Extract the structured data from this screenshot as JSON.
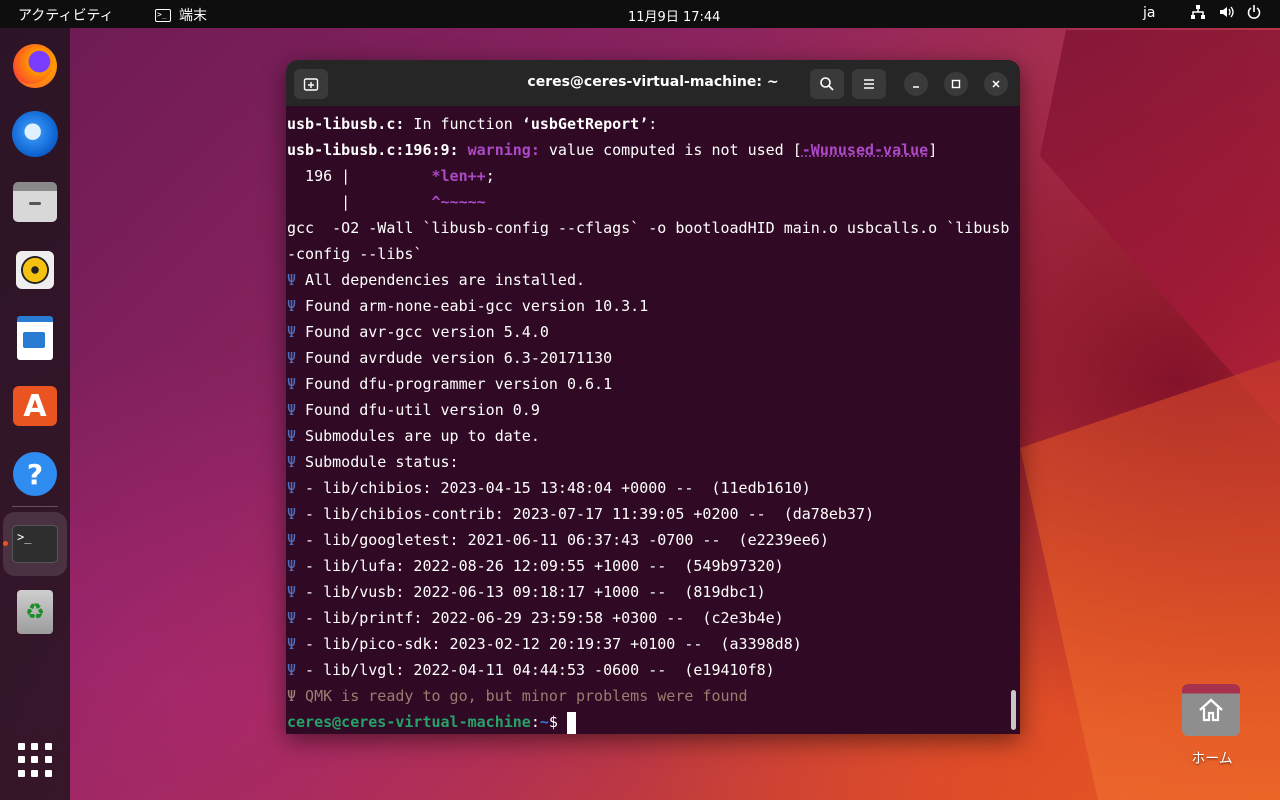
{
  "topbar": {
    "activities": "アクティビティ",
    "app_name": "端末",
    "clock": "11月9日  17:44",
    "lang": "ja"
  },
  "dock": {
    "items": [
      {
        "name": "firefox"
      },
      {
        "name": "thunderbird"
      },
      {
        "name": "files"
      },
      {
        "name": "rhythmbox"
      },
      {
        "name": "libreoffice-writer"
      },
      {
        "name": "ubuntu-software",
        "glyph": "A"
      },
      {
        "name": "help",
        "glyph": "?"
      },
      {
        "name": "terminal",
        "glyph": ">_"
      },
      {
        "name": "trash",
        "glyph": "♻"
      }
    ]
  },
  "desktop": {
    "home_label": "ホーム"
  },
  "terminal": {
    "title": "ceres@ceres-virtual-machine: ~",
    "lines": {
      "l1_file": "usb-libusb.c:",
      "l1_text": " In function ",
      "l1_func": "‘usbGetReport’",
      "l1_end": ":",
      "l2_loc": "usb-libusb.c:196:9:",
      "l2_warn": "warning:",
      "l2_text": " value computed is not used [",
      "l2_flag": "-Wunused-value",
      "l2_end": "]",
      "l3_num": "  196 |         ",
      "l3_code": "*len++",
      "l3_end": ";",
      "l4_pipe": "      |         ",
      "l4_caret": "^~~~~~",
      "l5": "gcc  -O2 -Wall `libusb-config --cflags` -o bootloadHID main.o usbcalls.o `libusb",
      "l6": "-config --libs`",
      "psi": "Ψ",
      "msgs": [
        " All dependencies are installed.",
        " Found arm-none-eabi-gcc version 10.3.1",
        " Found avr-gcc version 5.4.0",
        " Found avrdude version 6.3-20171130",
        " Found dfu-programmer version 0.6.1",
        " Found dfu-util version 0.9",
        " Submodules are up to date.",
        " Submodule status:",
        " - lib/chibios: 2023-04-15 13:48:04 +0000 --  (11edb1610)",
        " - lib/chibios-contrib: 2023-07-17 11:39:05 +0200 --  (da78eb37)",
        " - lib/googletest: 2021-06-11 06:37:43 -0700 --  (e2239ee6)",
        " - lib/lufa: 2022-08-26 12:09:55 +1000 --  (549b97320)",
        " - lib/vusb: 2022-06-13 09:18:17 +1000 --  (819dbc1)",
        " - lib/printf: 2022-06-29 23:59:58 +0300 --  (c2e3b4e)",
        " - lib/pico-sdk: 2023-02-12 20:19:37 +0100 --  (a3398d8)",
        " - lib/lvgl: 2022-04-11 04:44:53 -0600 --  (e19410f8)"
      ],
      "final_msg": " QMK is ready to go, but minor problems were found",
      "prompt_user": "ceres@ceres-virtual-machine",
      "prompt_sep": ":",
      "prompt_path": "~",
      "prompt_sym": "$ "
    }
  },
  "colors": {
    "terminal_bg": "#300a24",
    "accent": "#e95420",
    "warning": "#ad48c6",
    "prompt_green": "#26a269"
  }
}
